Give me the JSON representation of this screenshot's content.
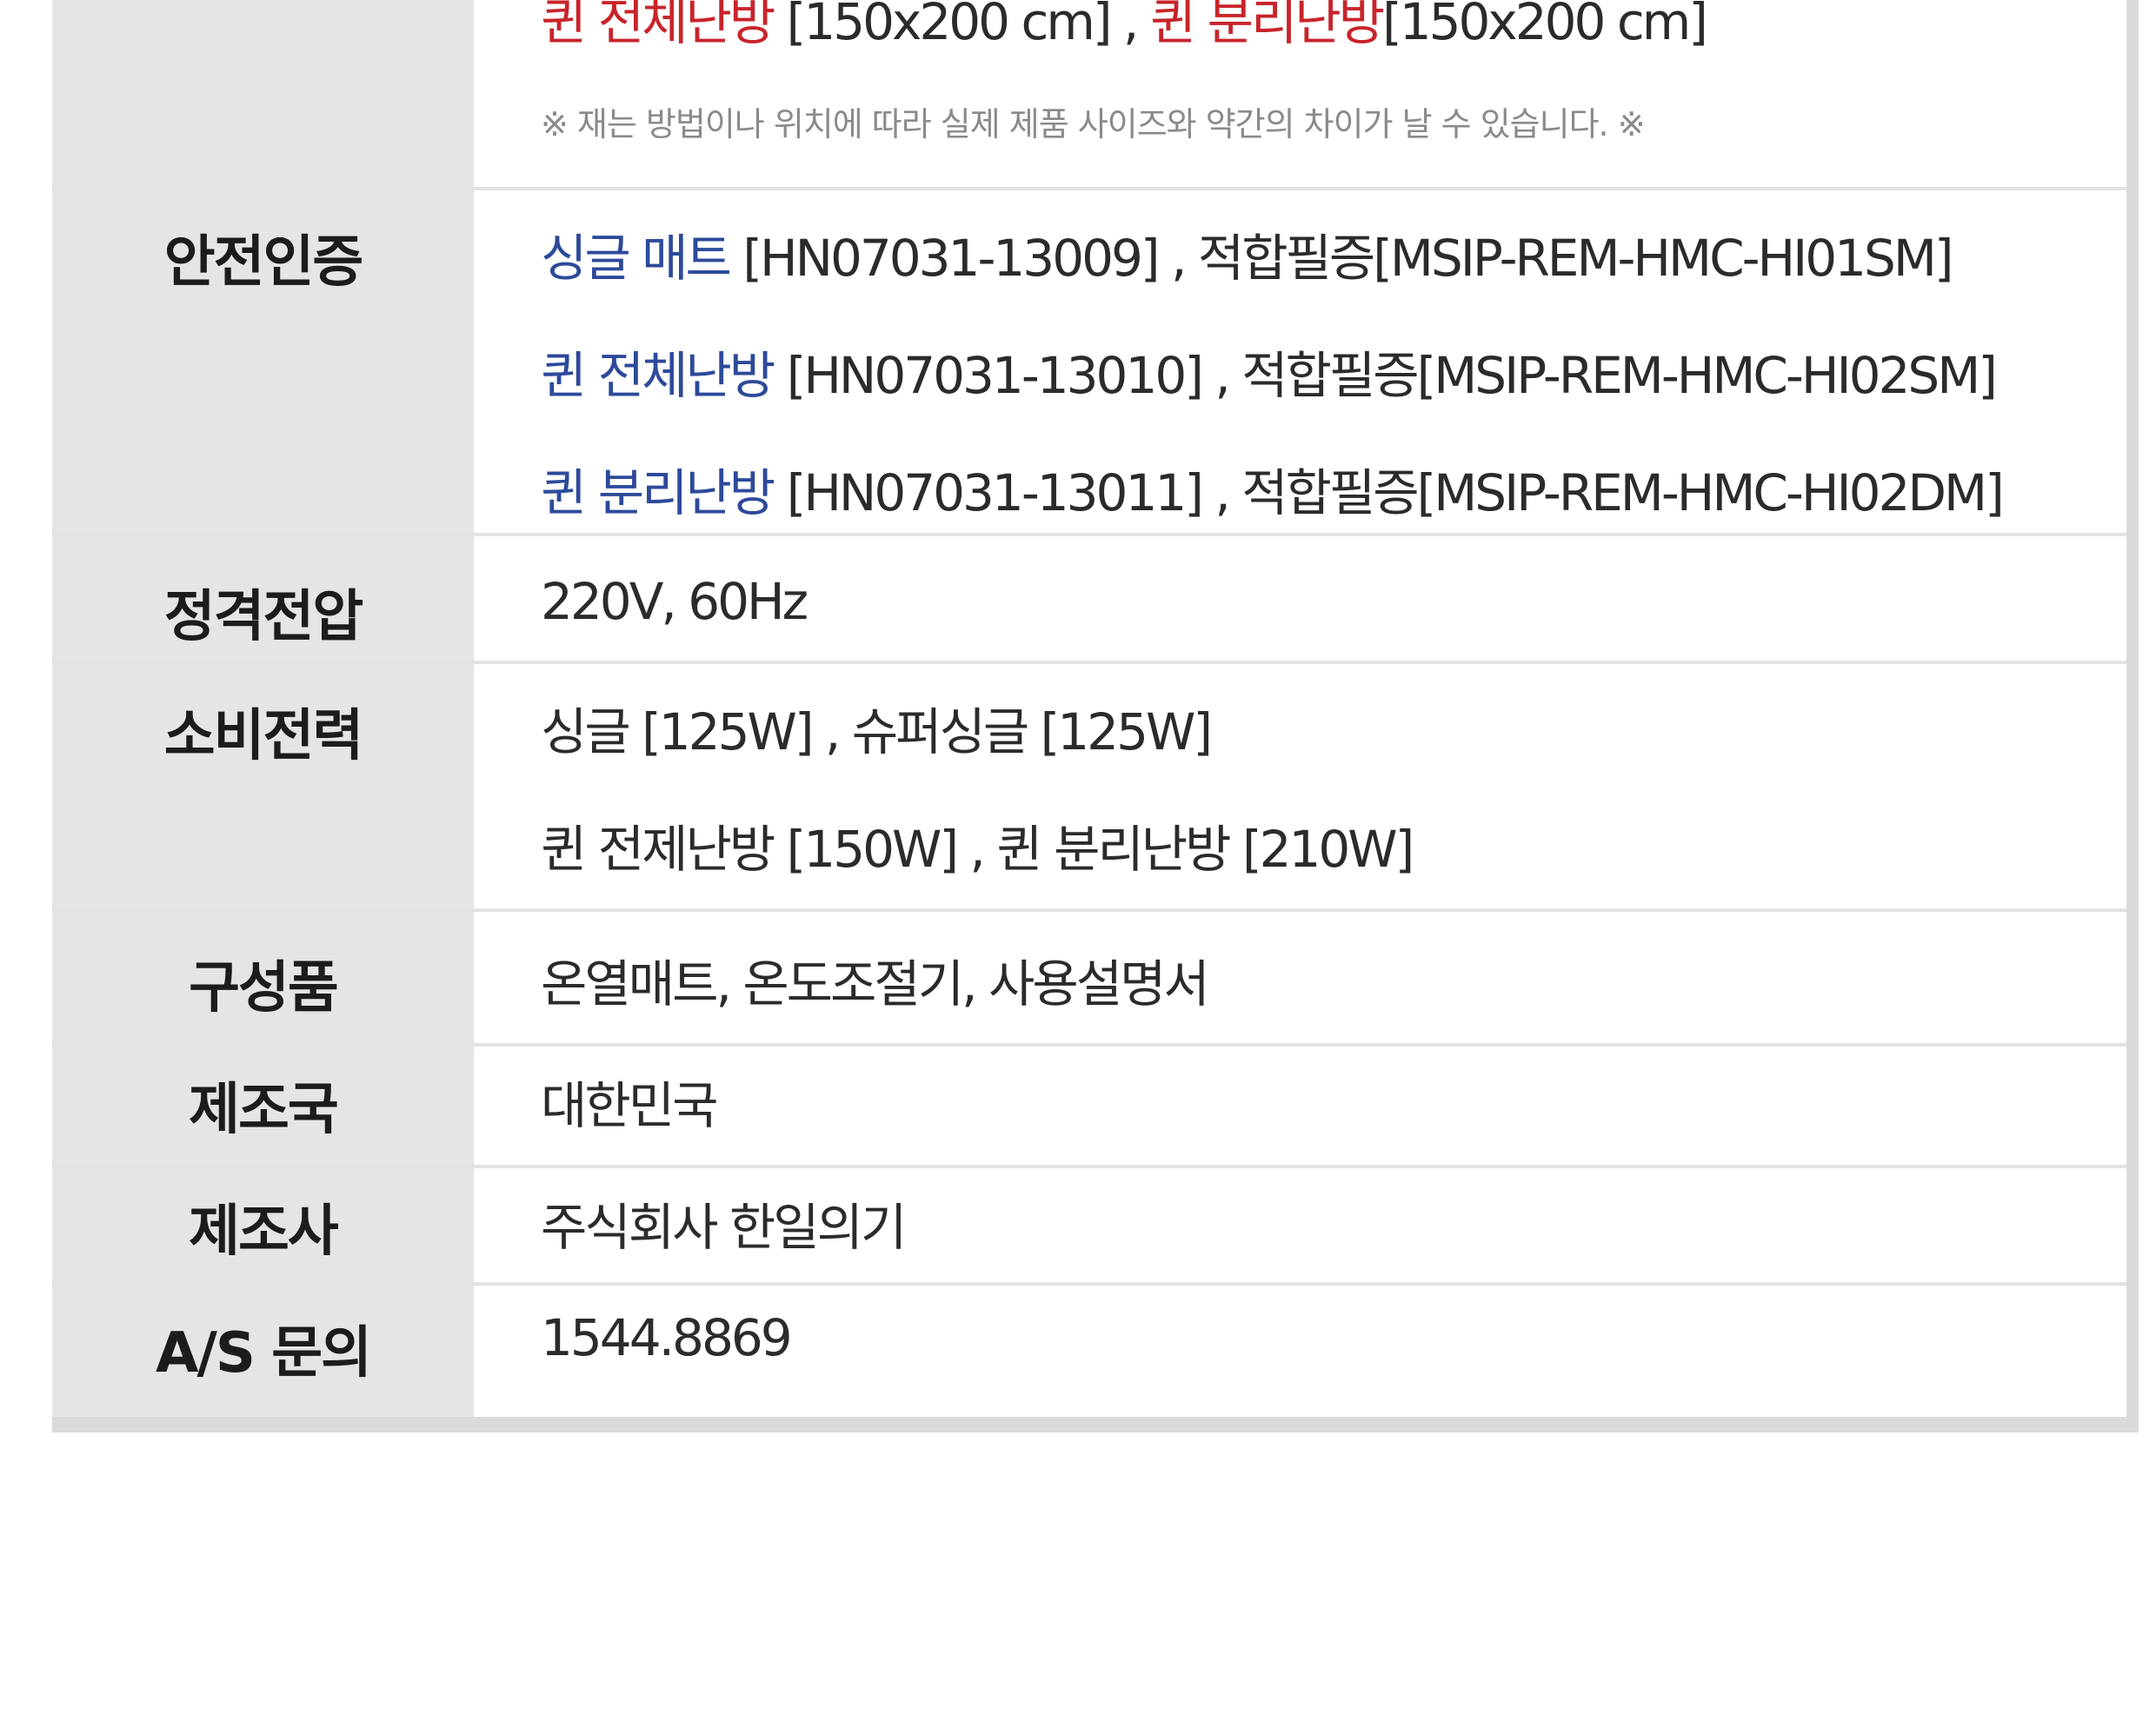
{
  "size": {
    "line_prefix": "퀸 전체난방",
    "line_prefix_size": " [150x200 cm] ,",
    "line_second": "퀸 분리난방",
    "line_second_size": "[150x200 cm]",
    "note": "※ 재는 방법이나 위치에 따라 실제 제품 사이즈와 약간의 차이가 날 수 있습니다. ※"
  },
  "rows": [
    {
      "label": "안전인증",
      "lines": [
        {
          "prefix": "싱글 매트",
          "text": "[HN07031-13009] , 적합필증[MSIP-REM-HMC-HI01SM]"
        },
        {
          "prefix": "퀸 전체난방",
          "text": "[HN07031-13010] , 적합필증[MSIP-REM-HMC-HI02SM]"
        },
        {
          "prefix": "퀸 분리난방",
          "text": "[HN07031-13011] , 적합필증[MSIP-REM-HMC-HI02DM]"
        }
      ]
    },
    {
      "label": "정격전압",
      "lines": [
        "220V, 60Hz"
      ]
    },
    {
      "label": "소비전력",
      "lines": [
        "싱글 [125W] , 슈퍼싱글 [125W]",
        "퀸 전제난방 [150W] , 퀸 분리난방 [210W]"
      ]
    },
    {
      "label": "구성품",
      "lines": [
        "온열매트, 온도조절기, 사용설명서"
      ]
    },
    {
      "label": "제조국",
      "lines": [
        "대한민국"
      ]
    },
    {
      "label": "제조사",
      "lines": [
        "주식회사 한일의기"
      ]
    },
    {
      "label": "A/S 문의",
      "lines": [
        "1544.8869"
      ]
    }
  ],
  "colors": {
    "prefix_red": "#c8242b",
    "prefix_blue": "#2d4a9a",
    "label_bg": "#e5e5e5"
  }
}
